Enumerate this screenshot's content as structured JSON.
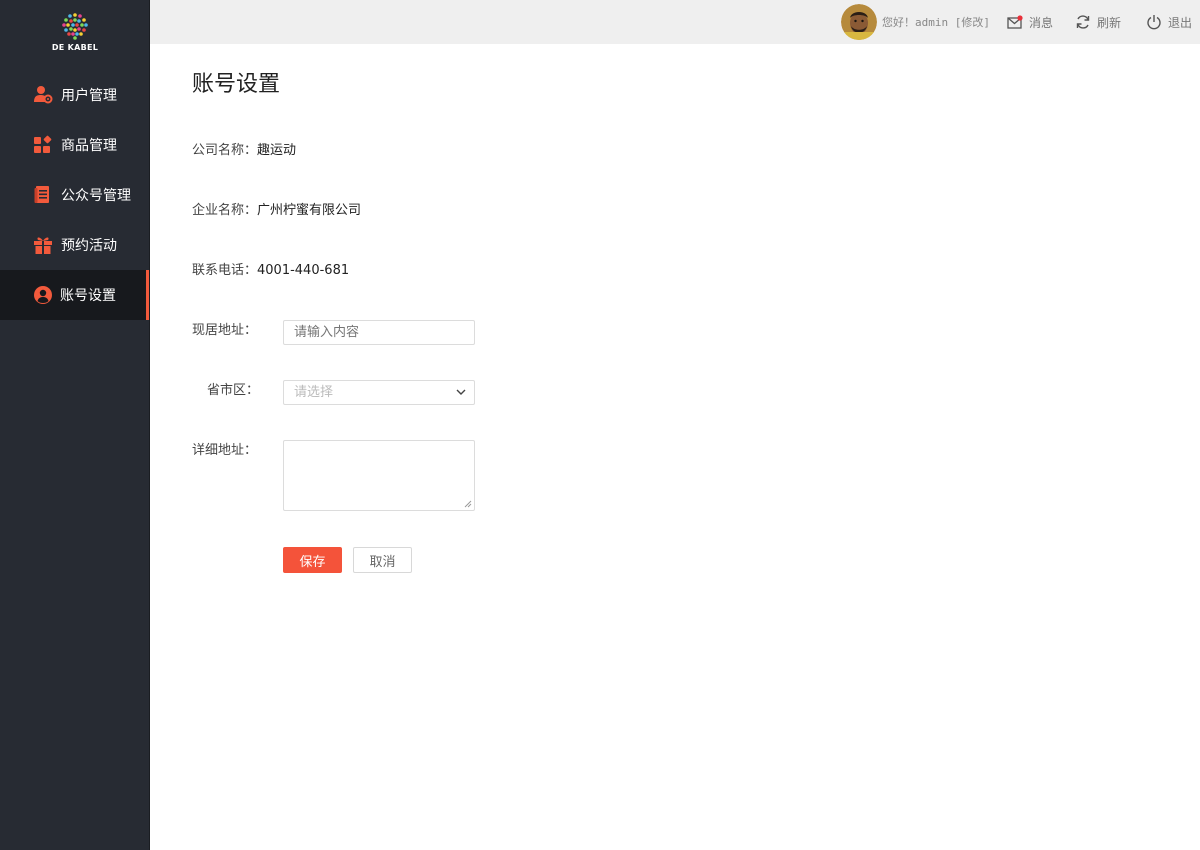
{
  "brand": {
    "logo_text": "DE KABEL"
  },
  "colors": {
    "accent": "#f25a3c",
    "sidebar_bg": "#272b33",
    "sidebar_active_bg": "#17191d",
    "topbar_bg": "#efefef"
  },
  "sidebar": {
    "items": [
      {
        "label": "用户管理",
        "icon": "user-settings-icon",
        "active": false
      },
      {
        "label": "商品管理",
        "icon": "product-grid-icon",
        "active": false
      },
      {
        "label": "公众号管理",
        "icon": "document-icon",
        "active": false
      },
      {
        "label": "预约活动",
        "icon": "gift-icon",
        "active": false
      },
      {
        "label": "账号设置",
        "icon": "user-circle-icon",
        "active": true
      }
    ]
  },
  "topbar": {
    "greeting": "您好！admin [修改]",
    "message_label": "消息",
    "refresh_label": "刷新",
    "logout_label": "退出"
  },
  "page": {
    "title": "账号设置",
    "info": [
      {
        "label": "公司名称：",
        "value": "趣运动"
      },
      {
        "label": "企业名称：",
        "value": "广州柠蜜有限公司"
      },
      {
        "label": "联系电话：",
        "value": "4001-440-681"
      }
    ],
    "form": {
      "address_label": "现居地址：",
      "address_placeholder": "请输入内容",
      "region_label": "省市区：",
      "region_placeholder": "请选择",
      "detail_label": "详细地址："
    },
    "buttons": {
      "save": "保存",
      "cancel": "取消"
    }
  }
}
